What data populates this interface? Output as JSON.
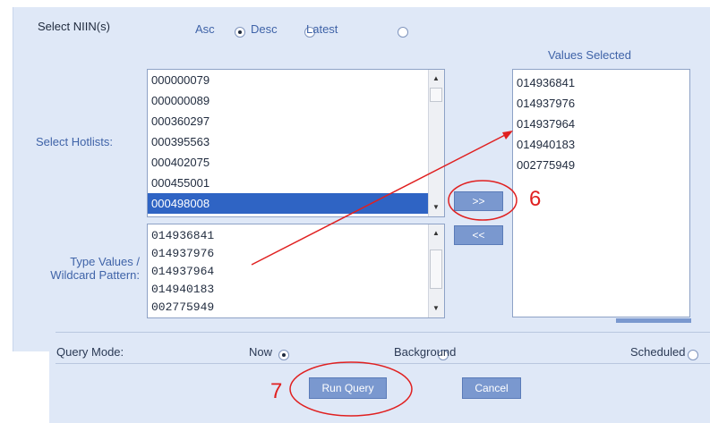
{
  "section_title": "Select NIIN(s)",
  "sort": {
    "asc_label": "Asc",
    "desc_label": "Desc",
    "latest_label": "Latest",
    "selected": "Asc"
  },
  "values_selected_header": "Values Selected",
  "hotlists": {
    "label": "Select Hotlists:",
    "items": [
      "000000079",
      "000000089",
      "000360297",
      "000395563",
      "000402075",
      "000455001",
      "000498008"
    ],
    "selected_item": "000498008"
  },
  "type_values": {
    "label_line1": "Type Values /",
    "label_line2": "Wildcard Pattern:",
    "lines": [
      "014936841",
      "014937976",
      "014937964",
      "014940183",
      "002775949"
    ]
  },
  "values_selected": [
    "014936841",
    "014937976",
    "014937964",
    "014940183",
    "002775949"
  ],
  "buttons": {
    "add": ">>",
    "remove": "<<",
    "run_query": "Run Query",
    "cancel": "Cancel"
  },
  "query_mode": {
    "label": "Query Mode:",
    "options": [
      "Now",
      "Background",
      "Scheduled"
    ],
    "selected": "Now"
  },
  "annotations": {
    "step6": "6",
    "step7": "7",
    "color": "#e02020"
  }
}
